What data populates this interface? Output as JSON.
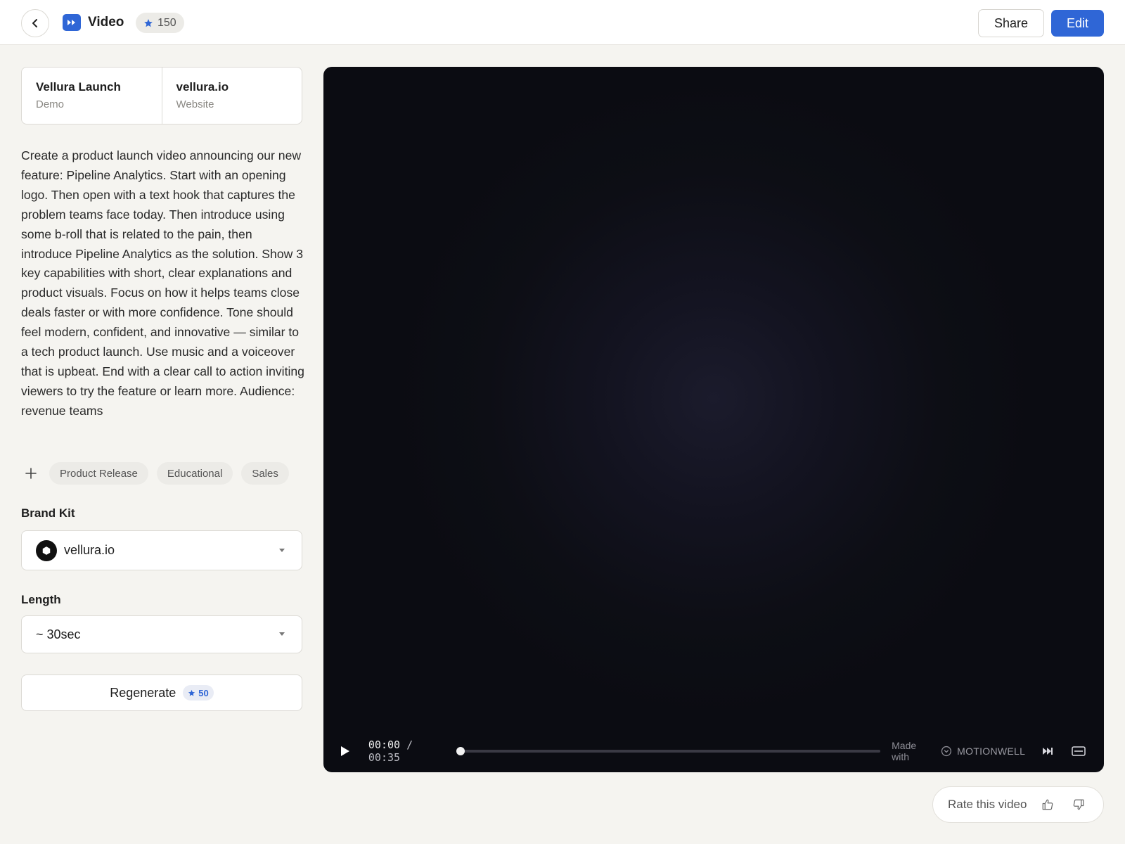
{
  "header": {
    "title": "Video",
    "credits": "150",
    "share_label": "Share",
    "edit_label": "Edit"
  },
  "project": {
    "name": "Vellura Launch",
    "type": "Demo",
    "source": "vellura.io",
    "source_type": "Website"
  },
  "prompt": "Create a product launch video announcing our new feature: Pipeline Analytics. Start with an opening logo. Then open with a text hook that captures the problem teams face today. Then introduce using some b-roll that is related to the pain, then introduce Pipeline Analytics as the solution. Show 3 key capabilities with short, clear explanations and product visuals. Focus on how it helps teams close deals faster or with more confidence. Tone should feel modern, confident, and innovative — similar to a tech product launch. Use music and a voiceover that is upbeat. End with a clear call to action inviting viewers to try the feature or learn more. Audience: revenue teams",
  "tags": [
    "Product Release",
    "Educational",
    "Sales"
  ],
  "brand_kit": {
    "label": "Brand Kit",
    "value": "vellura.io"
  },
  "length": {
    "label": "Length",
    "value": "~ 30sec"
  },
  "regenerate": {
    "label": "Regenerate",
    "cost": "50"
  },
  "player": {
    "current_time": "00:00",
    "separator": "/",
    "duration": "00:35",
    "progress": 0,
    "made_with": "Made with",
    "brand": "MOTIONWELL"
  },
  "rating": {
    "label": "Rate this video"
  },
  "colors": {
    "accent": "#2f66d6",
    "background": "#f5f4f0",
    "player_bg": "#0d0e15"
  }
}
